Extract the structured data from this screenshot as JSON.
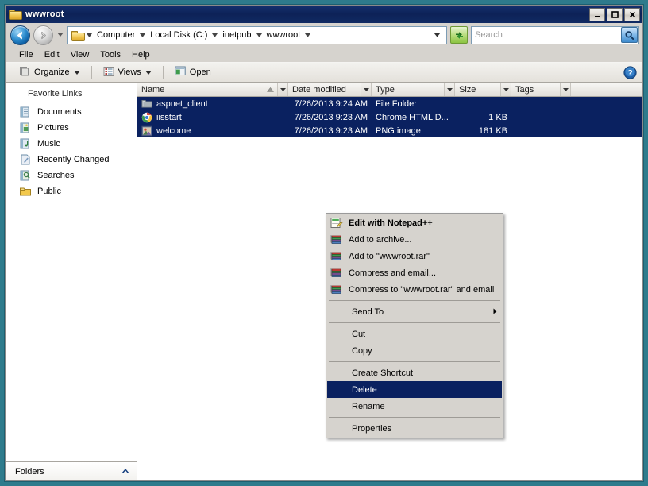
{
  "window": {
    "title": "wwwroot",
    "minimize_label": "Minimize",
    "maximize_label": "Maximize",
    "close_label": "Close"
  },
  "nav": {
    "back_label": "Back",
    "forward_label": "Forward",
    "history_label": "Recent pages",
    "refresh_label": "Refresh",
    "address_dropdown_label": "Previous locations"
  },
  "breadcrumbs": [
    "Computer",
    "Local Disk (C:)",
    "inetpub",
    "wwwroot"
  ],
  "search": {
    "placeholder": "Search",
    "value": "",
    "button_label": "Search"
  },
  "menubar": [
    "File",
    "Edit",
    "View",
    "Tools",
    "Help"
  ],
  "toolbar": {
    "organize_label": "Organize",
    "views_label": "Views",
    "open_label": "Open",
    "help_label": "Help"
  },
  "sidebar": {
    "title": "Favorite Links",
    "items": [
      {
        "label": "Documents",
        "icon": "documents-icon"
      },
      {
        "label": "Pictures",
        "icon": "pictures-icon"
      },
      {
        "label": "Music",
        "icon": "music-icon"
      },
      {
        "label": "Recently Changed",
        "icon": "recently-changed-icon"
      },
      {
        "label": "Searches",
        "icon": "searches-icon"
      },
      {
        "label": "Public",
        "icon": "public-folder-icon"
      }
    ],
    "folders_label": "Folders"
  },
  "filelist": {
    "columns": [
      {
        "label": "Name",
        "sorted": "ascending"
      },
      {
        "label": "Date modified",
        "sorted": ""
      },
      {
        "label": "Type",
        "sorted": ""
      },
      {
        "label": "Size",
        "sorted": ""
      },
      {
        "label": "Tags",
        "sorted": ""
      }
    ],
    "rows": [
      {
        "name": "aspnet_client",
        "date": "7/26/2013 9:24 AM",
        "type": "File Folder",
        "size": "",
        "tags": "",
        "icon": "folder-icon",
        "selected": true
      },
      {
        "name": "iisstart",
        "date": "7/26/2013 9:23 AM",
        "type": "Chrome HTML D...",
        "size": "1 KB",
        "tags": "",
        "icon": "chrome-file-icon",
        "selected": true
      },
      {
        "name": "welcome",
        "date": "7/26/2013 9:23 AM",
        "type": "PNG image",
        "size": "181 KB",
        "tags": "",
        "icon": "image-file-icon",
        "selected": true
      }
    ]
  },
  "context_menu": {
    "items": [
      {
        "label": "Edit with Notepad++",
        "icon": "notepadpp-icon",
        "bold": true,
        "highlighted": false,
        "submenu": false
      },
      {
        "label": "Add to archive...",
        "icon": "winrar-icon",
        "bold": false,
        "highlighted": false,
        "submenu": false
      },
      {
        "label": "Add to \"wwwroot.rar\"",
        "icon": "winrar-icon",
        "bold": false,
        "highlighted": false,
        "submenu": false
      },
      {
        "label": "Compress and email...",
        "icon": "winrar-icon",
        "bold": false,
        "highlighted": false,
        "submenu": false
      },
      {
        "label": "Compress to \"wwwroot.rar\" and email",
        "icon": "winrar-icon",
        "bold": false,
        "highlighted": false,
        "submenu": false
      },
      {
        "separator": true
      },
      {
        "label": "Send To",
        "icon": "",
        "bold": false,
        "highlighted": false,
        "submenu": true
      },
      {
        "separator": true
      },
      {
        "label": "Cut",
        "icon": "",
        "bold": false,
        "highlighted": false,
        "submenu": false
      },
      {
        "label": "Copy",
        "icon": "",
        "bold": false,
        "highlighted": false,
        "submenu": false
      },
      {
        "separator": true
      },
      {
        "label": "Create Shortcut",
        "icon": "",
        "bold": false,
        "highlighted": false,
        "submenu": false
      },
      {
        "label": "Delete",
        "icon": "",
        "bold": false,
        "highlighted": true,
        "submenu": false
      },
      {
        "label": "Rename",
        "icon": "",
        "bold": false,
        "highlighted": false,
        "submenu": false
      },
      {
        "separator": true
      },
      {
        "label": "Properties",
        "icon": "",
        "bold": false,
        "highlighted": false,
        "submenu": false
      }
    ]
  },
  "colors": {
    "selection": "#0a2160",
    "titlebar": "#102a63",
    "desktop": "#2e7b8c",
    "chrome": "#d6d3ce"
  }
}
